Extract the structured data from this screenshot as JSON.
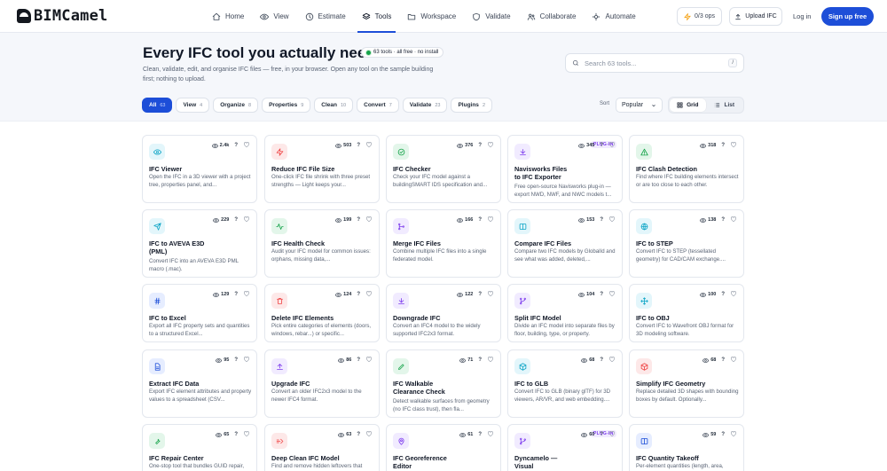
{
  "nav": {
    "logo": "BIMCamel",
    "links": [
      {
        "label": "Home",
        "icon": "home-icon"
      },
      {
        "label": "View",
        "icon": "eye-icon"
      },
      {
        "label": "Estimate",
        "icon": "estimate-icon"
      },
      {
        "label": "Tools",
        "icon": "layers-icon",
        "active": true
      },
      {
        "label": "Workspace",
        "icon": "folder-icon"
      },
      {
        "label": "Validate",
        "icon": "shield-icon"
      },
      {
        "label": "Collaborate",
        "icon": "users-icon"
      },
      {
        "label": "Automate",
        "icon": "automate-icon"
      }
    ],
    "ops": "0/3 ops",
    "upload": "Upload IFC",
    "login": "Log in",
    "signup": "Sign up free"
  },
  "hero": {
    "title": "Every IFC tool you actually need.",
    "badge": "63 tools · all free · no install",
    "subtitle": "Clean, validate, edit, and organise IFC files — free, in your browser. Open any tool on the sample building first; nothing to upload.",
    "search_placeholder": "Search 63 tools...",
    "search_shortcut": "/"
  },
  "filters": [
    {
      "label": "All",
      "count": "63",
      "active": true
    },
    {
      "label": "View",
      "count": "4"
    },
    {
      "label": "Organize",
      "count": "8"
    },
    {
      "label": "Properties",
      "count": "9"
    },
    {
      "label": "Clean",
      "count": "10"
    },
    {
      "label": "Convert",
      "count": "7"
    },
    {
      "label": "Validate",
      "count": "23"
    },
    {
      "label": "Plugins",
      "count": "2"
    }
  ],
  "sort": {
    "label": "Sort",
    "value": "Popular"
  },
  "view_toggle": {
    "grid": "Grid",
    "list": "List"
  },
  "colors": {
    "accent": "#1d4ed8",
    "plugin": "#7c3aed"
  },
  "tools": [
    {
      "title": "IFC Viewer",
      "desc": "Open the IFC in a 3D viewer with a project tree, properties panel, and...",
      "views": "2.4k",
      "icon": "eye-icon",
      "color": "#0ea5c6",
      "bg": "#e3f6fb"
    },
    {
      "title": "Reduce IFC File Size",
      "desc": "One-click IFC file shrink with three preset strengths — Light keeps your...",
      "views": "503",
      "icon": "bolt-icon",
      "color": "#ef4444",
      "bg": "#fde8e8"
    },
    {
      "title": "IFC Checker",
      "desc": "Check your IFC model against a buildingSMART IDS specification and...",
      "views": "376",
      "icon": "check-circle-icon",
      "color": "#16a34a",
      "bg": "#e3f6ea"
    },
    {
      "title": "Navisworks Files\nto IFC Exporter",
      "desc": "Free open-source Navisworks plug-in — export NWD, NWF, and NWC models t...",
      "views": "345",
      "icon": "download-icon",
      "color": "#7c3aed",
      "bg": "#f1ebff",
      "plugin": "PLUG-IN"
    },
    {
      "title": "IFC Clash Detection",
      "desc": "Find where IFC building elements intersect or are too close to each other.",
      "views": "318",
      "icon": "warning-icon",
      "color": "#16a34a",
      "bg": "#e3f6ea"
    },
    {
      "title": "IFC to AVEVA E3D\n(PML)",
      "desc": "Convert IFC into an AVEVA E3D PML macro (.mac).",
      "views": "229",
      "icon": "send-icon",
      "color": "#0ea5c6",
      "bg": "#e3f6fb"
    },
    {
      "title": "IFC Health Check",
      "desc": "Audit your IFC model for common issues: orphans, missing data,...",
      "views": "199",
      "icon": "activity-icon",
      "color": "#16a34a",
      "bg": "#e3f6ea"
    },
    {
      "title": "Merge IFC Files",
      "desc": "Combine multiple IFC files into a single federated model.",
      "views": "166",
      "icon": "merge-icon",
      "color": "#7c3aed",
      "bg": "#f1ebff"
    },
    {
      "title": "Compare IFC Files",
      "desc": "Compare two IFC models by GlobalId and see what was added, deleted,...",
      "views": "153",
      "icon": "columns-icon",
      "color": "#0ea5c6",
      "bg": "#e3f6fb"
    },
    {
      "title": "IFC to STEP",
      "desc": "Convert IFC to STEP (tessellated geometry) for CAD/CAM exchange....",
      "views": "138",
      "icon": "globe-icon",
      "color": "#0ea5c6",
      "bg": "#e3f6fb"
    },
    {
      "title": "IFC to Excel",
      "desc": "Export all IFC property sets and quantities to a structured Excel...",
      "views": "129",
      "icon": "hash-icon",
      "color": "#1d4ed8",
      "bg": "#e6edff"
    },
    {
      "title": "Delete IFC Elements",
      "desc": "Pick entire categories of elements (doors, windows, rebar...) or specific...",
      "views": "124",
      "icon": "trash-icon",
      "color": "#ef4444",
      "bg": "#fde8e8"
    },
    {
      "title": "Downgrade IFC",
      "desc": "Convert an IFC4 model to the widely supported IFC2x3 format.",
      "views": "122",
      "icon": "download-icon",
      "color": "#7c3aed",
      "bg": "#f1ebff"
    },
    {
      "title": "Split IFC Model",
      "desc": "Divide an IFC model into separate files by floor, building, type, or property.",
      "views": "104",
      "icon": "split-icon",
      "color": "#7c3aed",
      "bg": "#f1ebff"
    },
    {
      "title": "IFC to OBJ",
      "desc": "Convert IFC to Wavefront OBJ format for 3D modeling software.",
      "views": "100",
      "icon": "move-icon",
      "color": "#0ea5c6",
      "bg": "#e3f6fb"
    },
    {
      "title": "Extract IFC Data",
      "desc": "Export IFC element attributes and property values to a spreadsheet (CSV...",
      "views": "95",
      "icon": "file-icon",
      "color": "#1d4ed8",
      "bg": "#e6edff"
    },
    {
      "title": "Upgrade IFC",
      "desc": "Convert an older IFC2x3 model to the newer IFC4 format.",
      "views": "86",
      "icon": "upload-icon",
      "color": "#7c3aed",
      "bg": "#f1ebff"
    },
    {
      "title": "IFC Walkable\nClearance Check",
      "desc": "Detect walkable surfaces from geometry (no IFC class trust), then fla...",
      "views": "71",
      "icon": "pencil-icon",
      "color": "#16a34a",
      "bg": "#e3f6ea"
    },
    {
      "title": "IFC to GLB",
      "desc": "Convert IFC to GLB (binary glTF) for 3D viewers, AR/VR, and web embedding....",
      "views": "68",
      "icon": "cube-icon",
      "color": "#0ea5c6",
      "bg": "#e3f6fb"
    },
    {
      "title": "Simplify IFC Geometry",
      "desc": "Replace detailed 3D shapes with bounding boxes by default. Optionally...",
      "views": "68",
      "icon": "box-icon",
      "color": "#ef4444",
      "bg": "#fde8e8"
    },
    {
      "title": "IFC Repair Center",
      "desc": "One-stop tool that bundles GUID repair,",
      "views": "65",
      "icon": "wrench-icon",
      "color": "#16a34a",
      "bg": "#e3f6ea"
    },
    {
      "title": "Deep Clean IFC Model",
      "desc": "Find and remove hidden leftovers that",
      "views": "63",
      "icon": "clean-icon",
      "color": "#ef4444",
      "bg": "#fde8e8"
    },
    {
      "title": "IFC Georeference\nEditor",
      "desc": "",
      "views": "61",
      "icon": "map-pin-icon",
      "color": "#7c3aed",
      "bg": "#f1ebff"
    },
    {
      "title": "Dyncamelo —\nVisual",
      "desc": "",
      "views": "60",
      "icon": "branch-icon",
      "color": "#7c3aed",
      "bg": "#f1ebff",
      "plugin": "PLUG-IN"
    },
    {
      "title": "IFC Quantity Takeoff",
      "desc": "Per-element quantities (length, area,",
      "views": "59",
      "icon": "columns-icon",
      "color": "#1d4ed8",
      "bg": "#e6edff"
    }
  ]
}
